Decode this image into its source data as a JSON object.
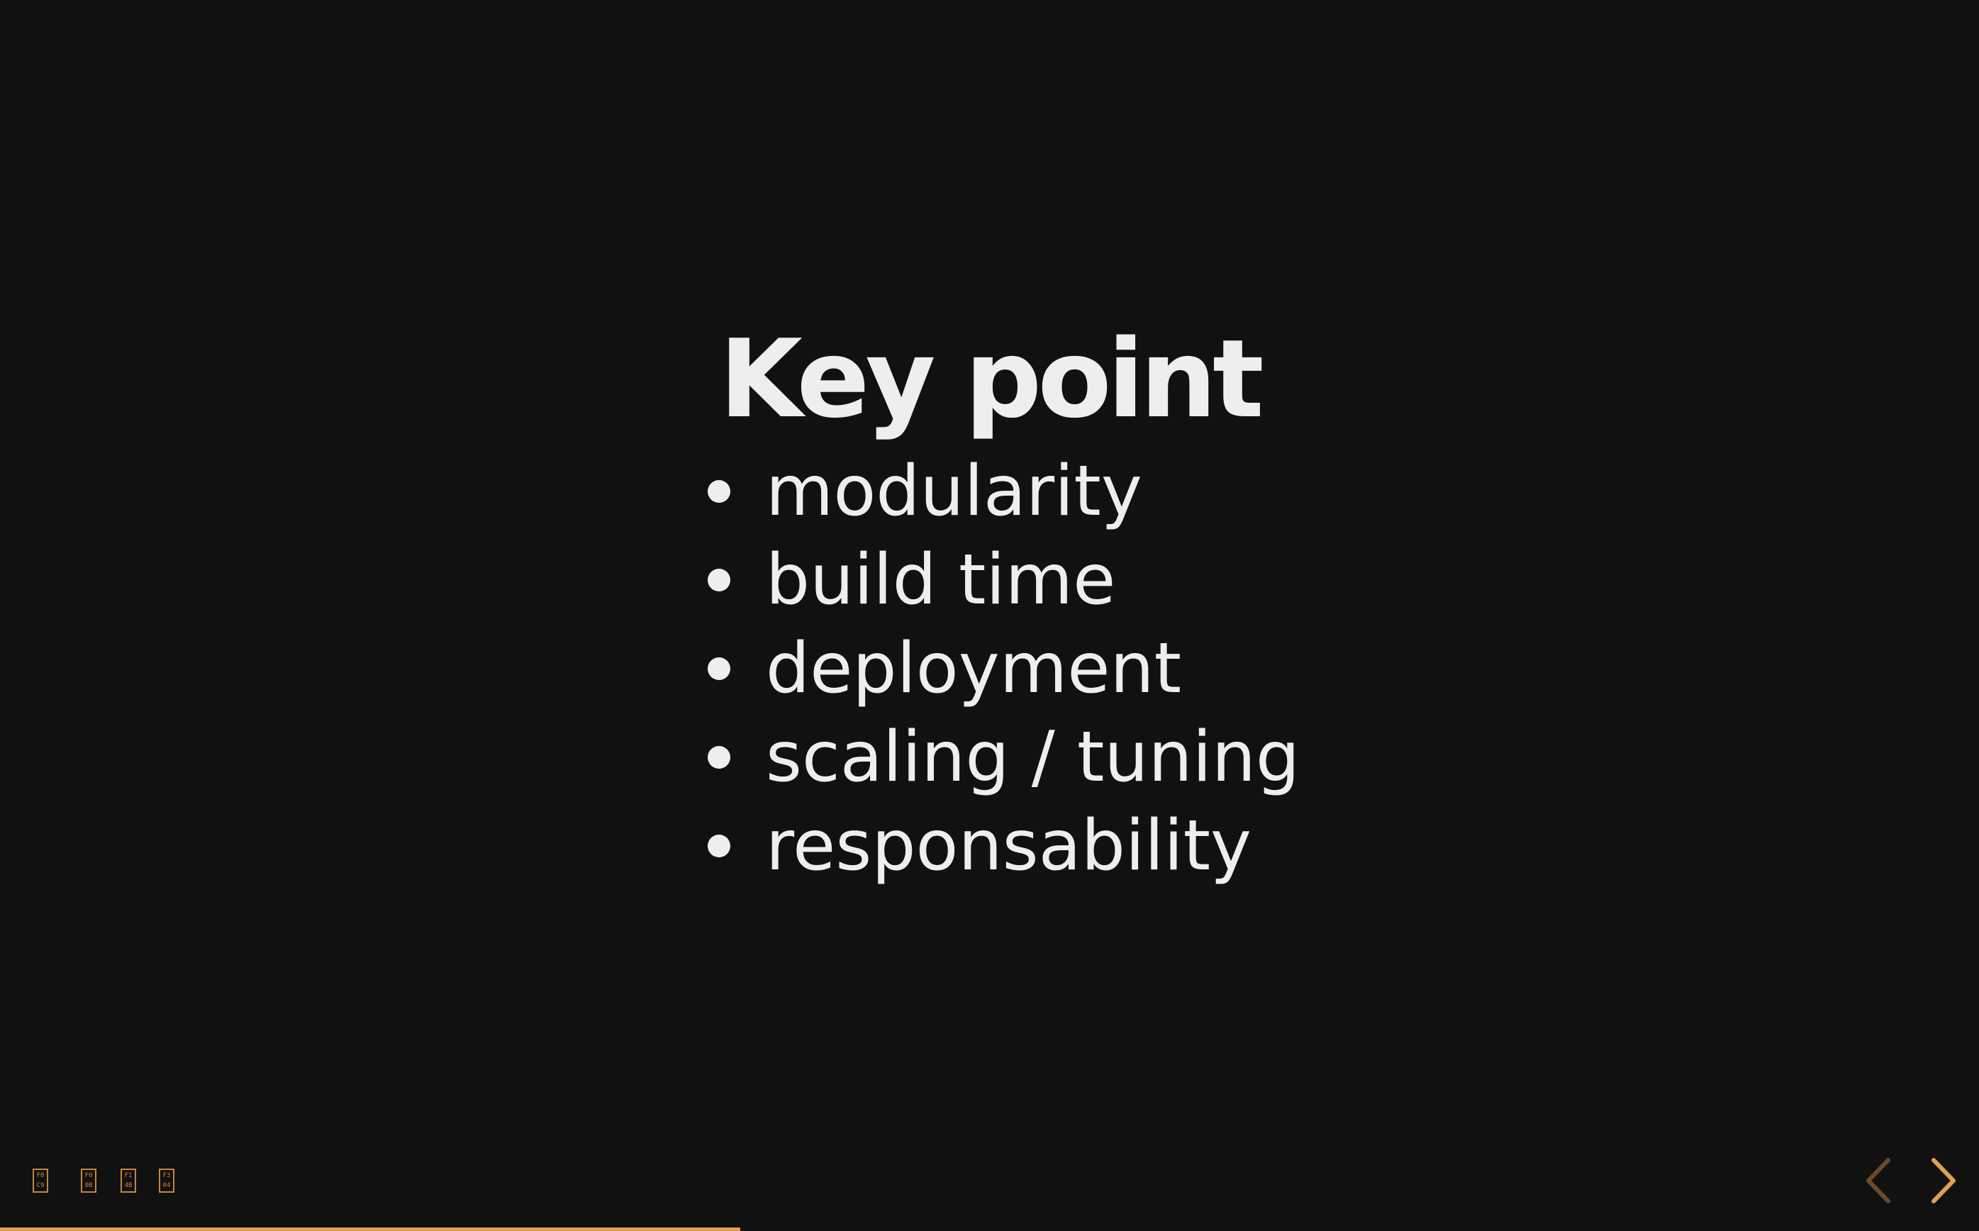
{
  "slide": {
    "title": "Key point",
    "bullets": [
      "modularity",
      "build time",
      "deployment",
      "scaling / tuning",
      "responsability"
    ]
  },
  "controls": {
    "icons": [
      {
        "name": "glyph-f0c9-icon",
        "top": "F0",
        "bottom": "C9"
      },
      {
        "name": "glyph-f00b-icon",
        "top": "F0",
        "bottom": "0B"
      },
      {
        "name": "glyph-f14b-icon",
        "top": "F1",
        "bottom": "4B"
      },
      {
        "name": "glyph-f304-icon",
        "top": "F3",
        "bottom": "04"
      }
    ]
  },
  "navigation": {
    "prev_icon": "chevron-left-icon",
    "next_icon": "chevron-right-icon"
  },
  "progress": {
    "fraction": 0.374
  },
  "colors": {
    "background": "#111111",
    "text": "#eeeeee",
    "accent": "#e0a050",
    "accent_dim": "#6b4a27"
  }
}
